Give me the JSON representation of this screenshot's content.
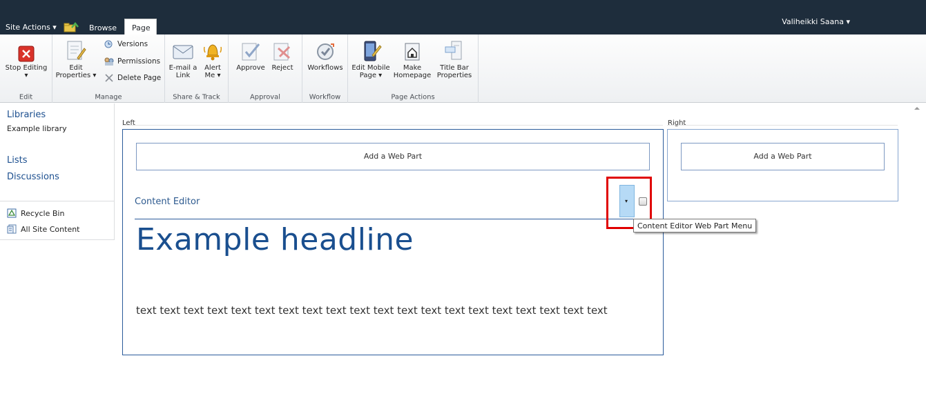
{
  "topbar": {
    "site_actions": "Site Actions ▾",
    "tabs": [
      {
        "label": "Browse"
      },
      {
        "label": "Page"
      }
    ],
    "user": "Valiheikki Saana ▾"
  },
  "ribbon": {
    "groups": {
      "edit": "Edit",
      "manage": "Manage",
      "share_track": "Share & Track",
      "approval": "Approval",
      "workflow": "Workflow",
      "page_actions": "Page Actions"
    },
    "buttons": {
      "stop_editing": "Stop Editing",
      "stop_editing_arrow": "▾",
      "edit_properties_1": "Edit",
      "edit_properties_2": "Properties ▾",
      "versions": "Versions",
      "permissions": "Permissions",
      "delete_page": "Delete Page",
      "email_link_1": "E-mail a",
      "email_link_2": "Link",
      "alert_me_1": "Alert",
      "alert_me_2": "Me ▾",
      "approve": "Approve",
      "reject": "Reject",
      "workflows": "Workflows",
      "edit_mobile_1": "Edit Mobile",
      "edit_mobile_2": "Page ▾",
      "make_homepage_1": "Make",
      "make_homepage_2": "Homepage",
      "title_bar_1": "Title Bar",
      "title_bar_2": "Properties"
    }
  },
  "leftnav": {
    "libraries": "Libraries",
    "example_library": "Example library",
    "lists": "Lists",
    "discussions": "Discussions",
    "recycle_bin": "Recycle Bin",
    "all_site_content": "All Site Content"
  },
  "zones": {
    "left_label": "Left",
    "right_label": "Right",
    "add_web_part": "Add a Web Part"
  },
  "webpart": {
    "title": "Content Editor",
    "menu_tooltip": "Content Editor Web Part Menu",
    "menu_arrow": "▾",
    "headline": "Example headline",
    "body": "text text text text text text text text text text text text text text text text text text text text"
  },
  "colors": {
    "topbar": "#1e2d3c",
    "link_blue": "#1c4f8f",
    "highlight": "#e00000"
  }
}
